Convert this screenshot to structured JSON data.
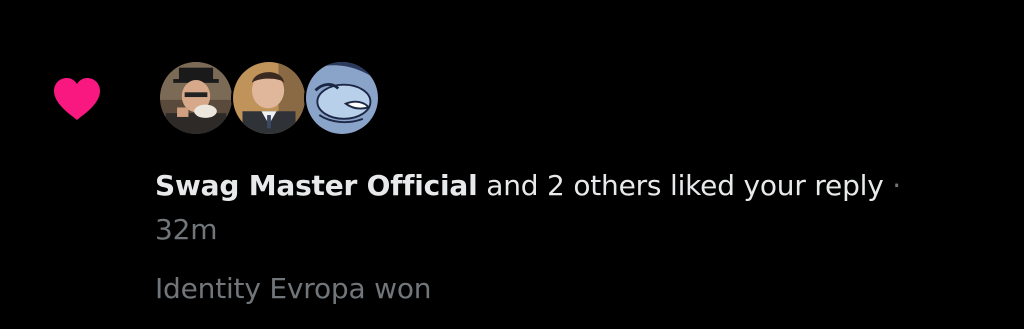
{
  "notification": {
    "icon": "heart-icon",
    "heart_color": "#f91880",
    "avatars": [
      {
        "icon": "avatar-man-with-top-hat-drinking-tea"
      },
      {
        "icon": "avatar-man-in-suit"
      },
      {
        "icon": "avatar-anime-drawing"
      }
    ],
    "actor_name": "Swag Master Official",
    "action_text": " and 2 others liked your reply",
    "separator": " · ",
    "time": "32m",
    "snippet": "Identity Evropa won"
  }
}
